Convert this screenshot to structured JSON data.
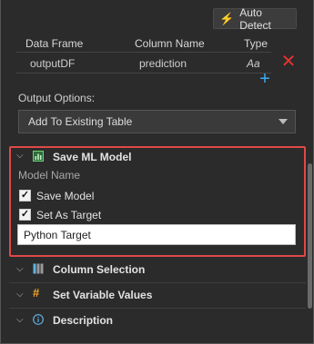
{
  "toolbar": {
    "auto_detect_label": "Auto Detect"
  },
  "mapping_table": {
    "headers": {
      "data_frame": "Data Frame",
      "column_name": "Column Name",
      "type": "Type"
    },
    "rows": [
      {
        "data_frame": "outputDF",
        "column_name": "prediction",
        "type": "Aa"
      }
    ]
  },
  "output_options": {
    "label": "Output Options:",
    "selected": "Add To Existing Table"
  },
  "save_ml_model": {
    "title": "Save ML Model",
    "model_name_label": "Model Name",
    "save_model": {
      "label": "Save Model",
      "checked": true
    },
    "set_as_target": {
      "label": "Set As Target",
      "checked": true
    },
    "target_name_value": "Python Target"
  },
  "sections": {
    "column_selection": "Column Selection",
    "set_variable_values": "Set Variable Values",
    "description": "Description"
  },
  "colors": {
    "accent_red": "#e04848",
    "delete_red": "#e3342f",
    "add_blue": "#3fa9f5",
    "bolt_orange": "#f5a623"
  },
  "icons": {
    "auto_detect": "lightning-bolt-icon",
    "delete": "delete-x-icon",
    "add": "add-plus-icon",
    "save_ml_model": "ml-model-icon",
    "column_selection": "columns-icon",
    "set_variable_values": "hash-variable-icon",
    "description": "info-circle-icon"
  }
}
